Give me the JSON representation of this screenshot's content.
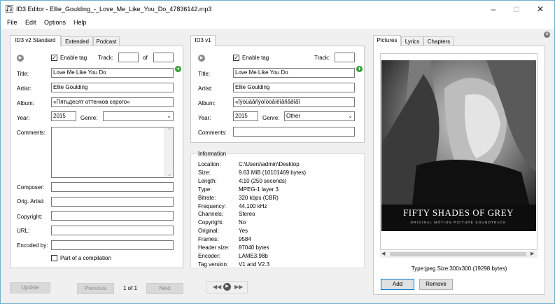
{
  "window": {
    "title": "ID3 Editor - Ellie_Goulding_-_Love_Me_Like_You_Do_47836142.mp3"
  },
  "menu": [
    "File",
    "Edit",
    "Options",
    "Help"
  ],
  "left_tabs": [
    "ID3 v2 Standard",
    "Extended",
    "Podcast"
  ],
  "v2": {
    "enable_tag_label": "Enable tag",
    "track_label": "Track:",
    "of_label": "of",
    "track_value": "",
    "track_total": "",
    "title_label": "Title:",
    "title": "Love Me Like You Do",
    "artist_label": "Artist:",
    "artist": "Ellie Goulding",
    "album_label": "Album:",
    "album": "«Пятьдесят оттенков серого»",
    "year_label": "Year:",
    "year": "2015",
    "genre_label": "Genre:",
    "genre": "",
    "comments_label": "Comments:",
    "comments": "",
    "composer_label": "Composer:",
    "composer": "",
    "orig_artist_label": "Orig. Artist:",
    "orig_artist": "",
    "copyright_label": "Copyright:",
    "copyright": "",
    "url_label": "URL:",
    "url": "",
    "encoded_by_label": "Encoded by:",
    "encoded_by": "",
    "compilation_label": "Part of a compilation"
  },
  "v1": {
    "tab": "ID3 v1",
    "enable_tag_label": "Enable tag",
    "track_label": "Track:",
    "track_value": "",
    "title_label": "Title:",
    "title": "Love Me Like You Do",
    "artist_label": "Artist:",
    "artist": "Ellie Goulding",
    "album_label": "Album:",
    "album": "«Ïÿòüäåñÿòîòòåíêîâñåðîãî",
    "year_label": "Year:",
    "year": "2015",
    "genre_label": "Genre:",
    "genre": "Other",
    "comments_label": "Comments:",
    "comments": ""
  },
  "info": {
    "header": "Information",
    "rows": [
      {
        "k": "Location:",
        "v": "C:\\Users\\admin\\Desktop"
      },
      {
        "k": "Size:",
        "v": "9.63 MiB (10101469 bytes)"
      },
      {
        "k": "Length:",
        "v": "4:10 (250 seconds)"
      },
      {
        "k": "Type:",
        "v": "MPEG-1 layer 3"
      },
      {
        "k": "Bitrate:",
        "v": "320 kbps (CBR)"
      },
      {
        "k": "Frequency:",
        "v": "44.100 kHz"
      },
      {
        "k": "Channels:",
        "v": "Stereo"
      },
      {
        "k": "Copyright:",
        "v": "No"
      },
      {
        "k": "Original:",
        "v": "Yes"
      },
      {
        "k": "Frames:",
        "v": "9584"
      },
      {
        "k": "Header size:",
        "v": "87040 bytes"
      },
      {
        "k": "Encoder:",
        "v": "LAME3.98b"
      },
      {
        "k": "Tag version:",
        "v": "V1 and V2.3"
      }
    ]
  },
  "right_tabs": [
    "Pictures",
    "Lyrics",
    "Chapters"
  ],
  "picture": {
    "title_line": "FIFTY SHADES OF GREY",
    "subtitle_line": "ORIGINAL MOTION PICTURE SOUNDTRACK",
    "type_info": "Type:jpeg  Size:300x300 (19298 bytes)",
    "add_label": "Add",
    "remove_label": "Remove"
  },
  "bottom": {
    "update_label": "Update",
    "previous_label": "Previous",
    "page_label": "1 of 1",
    "next_label": "Next"
  },
  "icons": [
    "app-icon",
    "minimize-icon",
    "maximize-icon",
    "close-icon",
    "play-icon",
    "add-icon",
    "rewind-icon",
    "fast-forward-icon",
    "close-panel-icon",
    "dropdown-arrow-icon",
    "checkmark-icon"
  ]
}
